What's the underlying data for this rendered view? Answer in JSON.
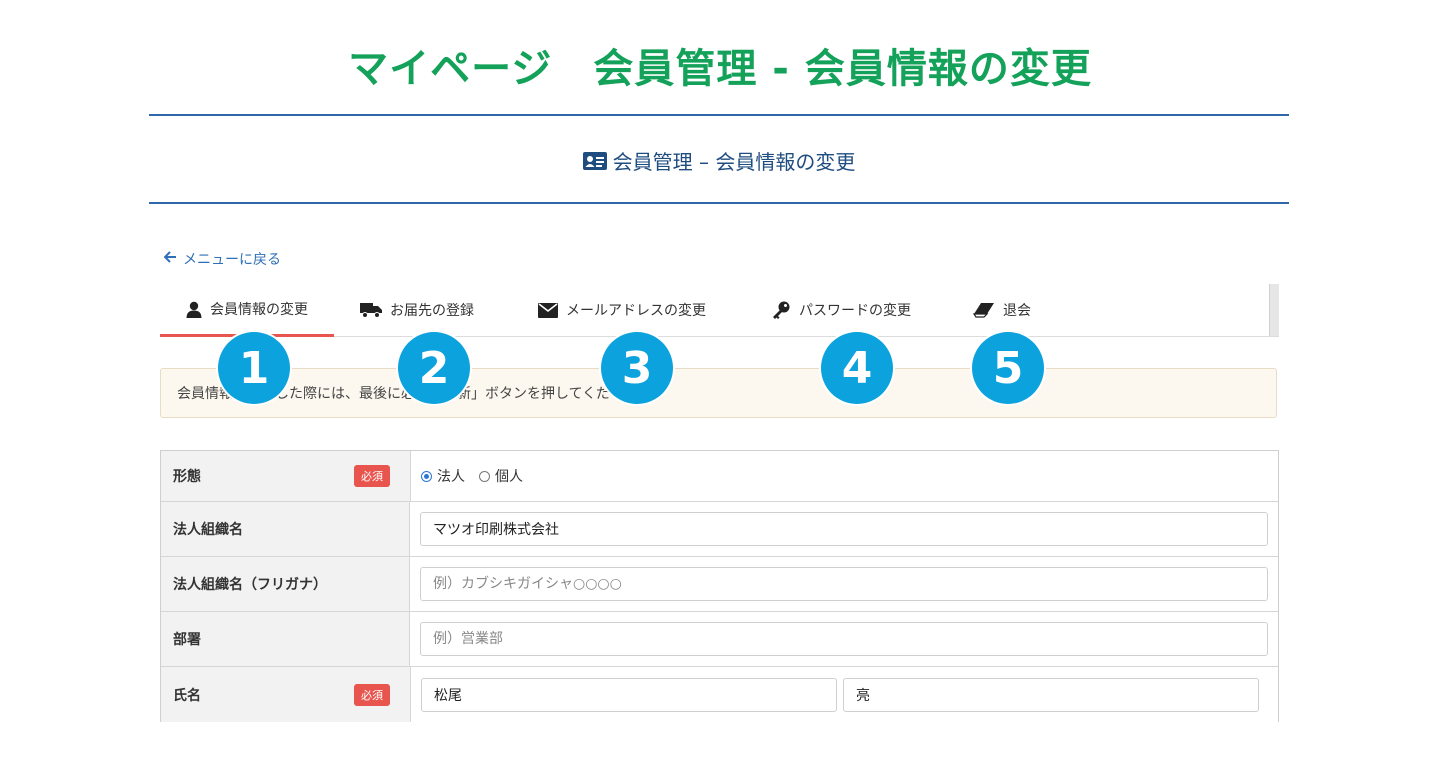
{
  "page_heading": "マイページ　会員管理 - 会員情報の変更",
  "section_title": "会員管理 – 会員情報の変更",
  "back_link": "メニューに戻る",
  "tabs": [
    {
      "label": "会員情報の変更",
      "icon": "user-icon",
      "active": true,
      "marker": "1"
    },
    {
      "label": "お届先の登録",
      "icon": "truck-icon",
      "active": false,
      "marker": "2"
    },
    {
      "label": "メールアドレスの変更",
      "icon": "envelope-icon",
      "active": false,
      "marker": "3"
    },
    {
      "label": "パスワードの変更",
      "icon": "key-icon",
      "active": false,
      "marker": "4"
    },
    {
      "label": "退会",
      "icon": "eraser-icon",
      "active": false,
      "marker": "5"
    }
  ],
  "notice": "会員情報を変更した際には、最後に必ず「更新」ボタンを押してください。",
  "required_label": "必須",
  "form": {
    "type": {
      "label": "形態",
      "required": true,
      "options": [
        "法人",
        "個人"
      ],
      "selected": "法人"
    },
    "org_name": {
      "label": "法人組織名",
      "value": "マツオ印刷株式会社",
      "placeholder": ""
    },
    "org_name_kana": {
      "label": "法人組織名（フリガナ）",
      "value": "",
      "placeholder": "例）カブシキガイシャ○○○○"
    },
    "department": {
      "label": "部署",
      "value": "",
      "placeholder": "例）営業部"
    },
    "name": {
      "label": "氏名",
      "required": true,
      "last_name": "松尾",
      "first_name": "亮"
    }
  },
  "colors": {
    "heading_green": "#14a15a",
    "accent_blue": "#2f67a8",
    "active_tab": "#e8554e",
    "marker_blue": "#0ba2dd"
  }
}
